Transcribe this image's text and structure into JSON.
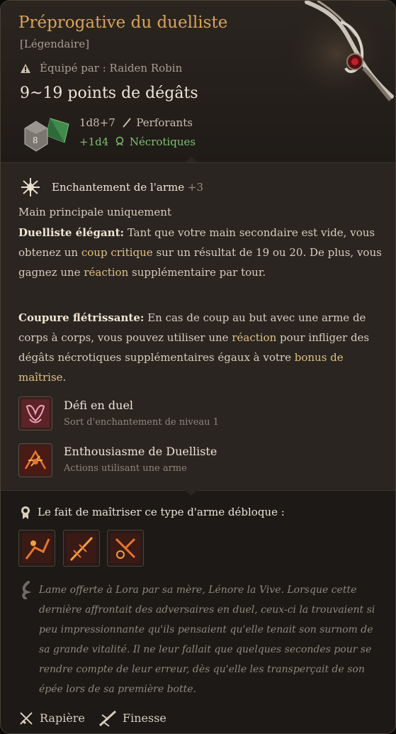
{
  "item": {
    "title": "Préprogative du duelliste",
    "rarity": "[Légendaire]",
    "equipped_by": "Équipé par : Raiden Robin",
    "damage": "9~19 points de dégâts",
    "die_badge": "8"
  },
  "damage_lines": [
    {
      "dice": "1d8+7",
      "type": "Perforants"
    },
    {
      "dice": "+1d4",
      "type": "Nécrotiques"
    }
  ],
  "enchantment": {
    "label": "Enchantement de l'arme",
    "bonus": "+3"
  },
  "description": {
    "main_hand": "Main principale uniquement",
    "elegant_title": "Duelliste élégant:",
    "elegant_1": "Tant que votre main secondaire est vide, vous obtenez un",
    "elegant_hl1": "coup critique",
    "elegant_2": "sur un résultat de 19 ou 20. De plus, vous gagnez une",
    "elegant_hl2": "réaction",
    "elegant_3": "supplémentaire par tour.",
    "withering_title": "Coupure flétrissante:",
    "withering_1": "En cas de coup au but avec une arme de corps à corps, vous pouvez utiliser une",
    "withering_hl1": "réaction",
    "withering_2": "pour infliger des dégâts nécrotiques supplémentaires égaux à votre",
    "withering_hl2": "bonus de maîtrise",
    "withering_3": "."
  },
  "spells": [
    {
      "name": "Défi en duel",
      "sub": "Sort d'enchantement de niveau 1"
    },
    {
      "name": "Enthousiasme de Duelliste",
      "sub": "Actions utilisant une arme"
    }
  ],
  "proficiency": {
    "label": "Le fait de maîtriser ce type d'arme débloque :"
  },
  "lore": "Lame offerte à Lora par sa mère, Lénore la Vive. Lorsque cette dernière affrontait des adversaires en duel, ceux-ci la trouvaient si peu impressionnante qu'ils pensaient qu'elle tenait son surnom de sa grande vitalité. Il ne leur fallait que quelques secondes pour se rendre compte de leur erreur, dès qu'elle les transperçait de son épée lors de sa première botte.",
  "tags": [
    "Rapière",
    "Finesse"
  ],
  "colors": {
    "title": "#d9a35b",
    "necrotic": "#7fc06f",
    "highlight": "#e0c181"
  }
}
